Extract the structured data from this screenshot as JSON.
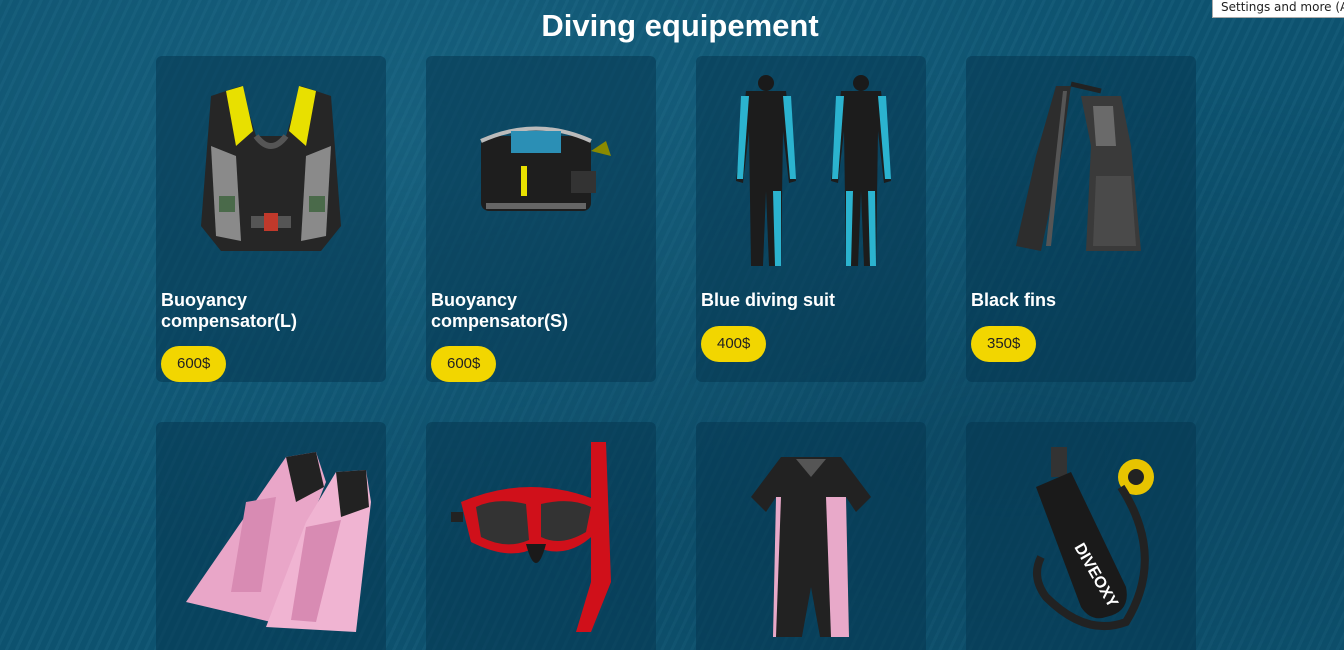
{
  "page": {
    "title": "Diving equipement"
  },
  "browser_tooltip": "Settings and more (Alt+F)",
  "products": [
    {
      "name": "Buoyancy compensator(L)",
      "price": "600$",
      "icon": "vest-icon"
    },
    {
      "name": "Buoyancy compensator(S)",
      "price": "600$",
      "icon": "bcd-icon"
    },
    {
      "name": "Blue diving suit",
      "price": "400$",
      "icon": "wetsuit-icon"
    },
    {
      "name": "Black fins",
      "price": "350$",
      "icon": "black-fins-icon"
    },
    {
      "name": "",
      "price": "",
      "icon": "pink-fins-icon"
    },
    {
      "name": "",
      "price": "",
      "icon": "mask-snorkel-icon"
    },
    {
      "name": "",
      "price": "",
      "icon": "shorty-suit-icon"
    },
    {
      "name": "",
      "price": "",
      "icon": "tank-icon"
    }
  ],
  "colors": {
    "background": "#0d5573",
    "price_badge": "#f2d600",
    "card": "rgba(5,55,80,0.55)"
  }
}
